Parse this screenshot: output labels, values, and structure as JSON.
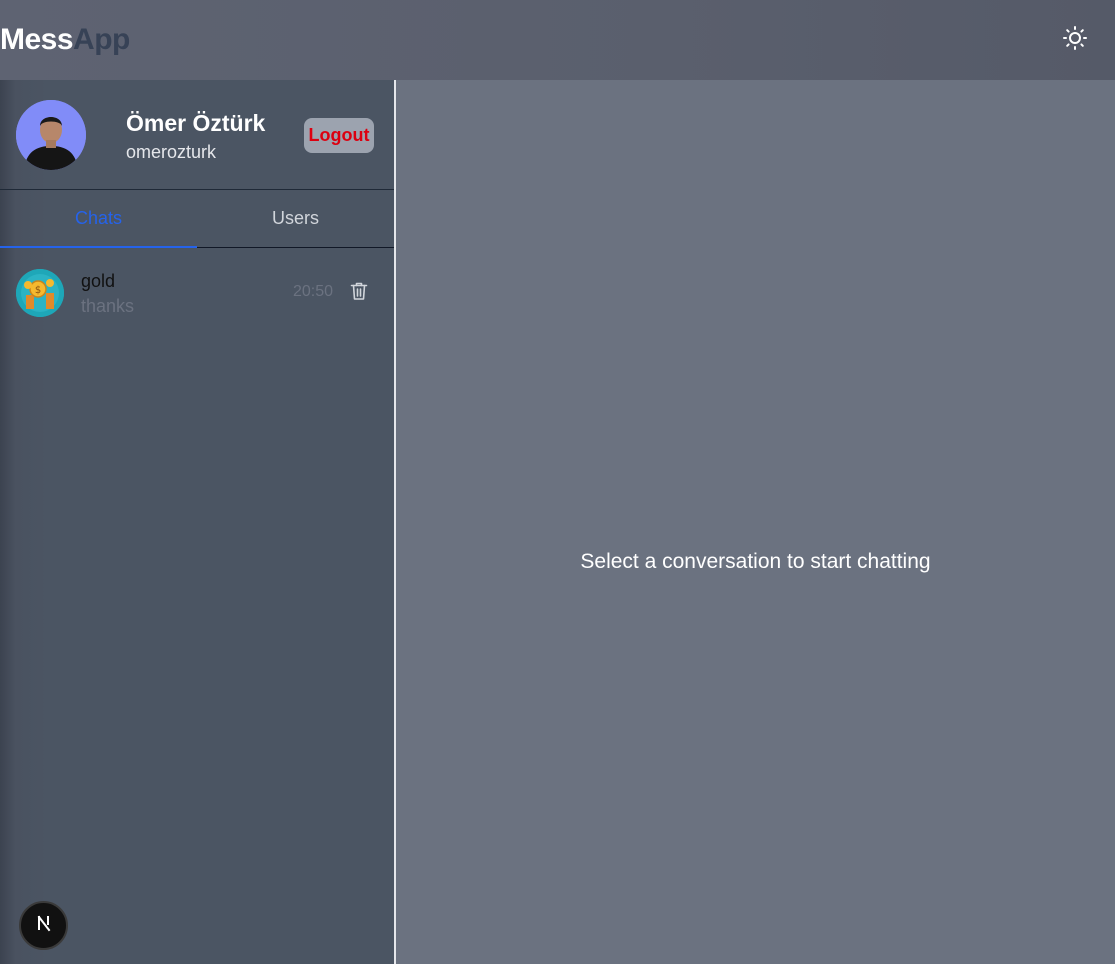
{
  "header": {
    "brand_part1": "Mess",
    "brand_part2": "App",
    "theme_toggle_icon": "sun-icon"
  },
  "profile": {
    "name": "Ömer Öztürk",
    "username": "omerozturk",
    "logout_label": "Logout",
    "avatar_icon": "user-avatar"
  },
  "tabs": [
    {
      "label": "Chats",
      "active": true
    },
    {
      "label": "Users",
      "active": false
    }
  ],
  "chats": [
    {
      "name": "gold",
      "last_message": "thanks",
      "time": "20:50",
      "delete_icon": "trash-icon"
    }
  ],
  "main": {
    "empty_state": "Select a conversation to start chatting"
  },
  "colors": {
    "accent": "#2563eb",
    "logout_text": "#dc0010",
    "sidebar_bg": "#4b5563",
    "main_bg": "#6b7280"
  }
}
